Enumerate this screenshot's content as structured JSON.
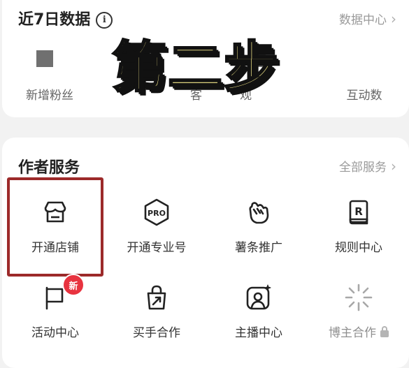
{
  "data_section": {
    "title": "近7日数据",
    "info_icon": "info-icon",
    "link": "数据中心",
    "stats": [
      {
        "label": "新增粉丝"
      },
      {
        "label": "客"
      },
      {
        "label": "观"
      },
      {
        "label": "互动数"
      }
    ]
  },
  "overlay": {
    "text": "第二步",
    "fill_color": "#f5e98a",
    "outline_color": "#111111"
  },
  "services": {
    "title": "作者服务",
    "link": "全部服务",
    "items": [
      {
        "label": "开通店铺",
        "icon": "store-icon",
        "highlighted": true
      },
      {
        "label": "开通专业号",
        "icon": "pro-badge-icon",
        "icon_text": "PRO"
      },
      {
        "label": "薯条推广",
        "icon": "fist-icon"
      },
      {
        "label": "规则中心",
        "icon": "rulebook-icon",
        "icon_text": "R"
      },
      {
        "label": "活动中心",
        "icon": "flag-icon",
        "badge": "新"
      },
      {
        "label": "买手合作",
        "icon": "shopping-bag-icon"
      },
      {
        "label": "主播中心",
        "icon": "streamer-icon"
      },
      {
        "label": "博主合作",
        "icon": "sparkle-icon",
        "locked": true
      }
    ]
  },
  "colors": {
    "highlight_border": "#9c2a2a",
    "badge_red": "#e8333f"
  }
}
